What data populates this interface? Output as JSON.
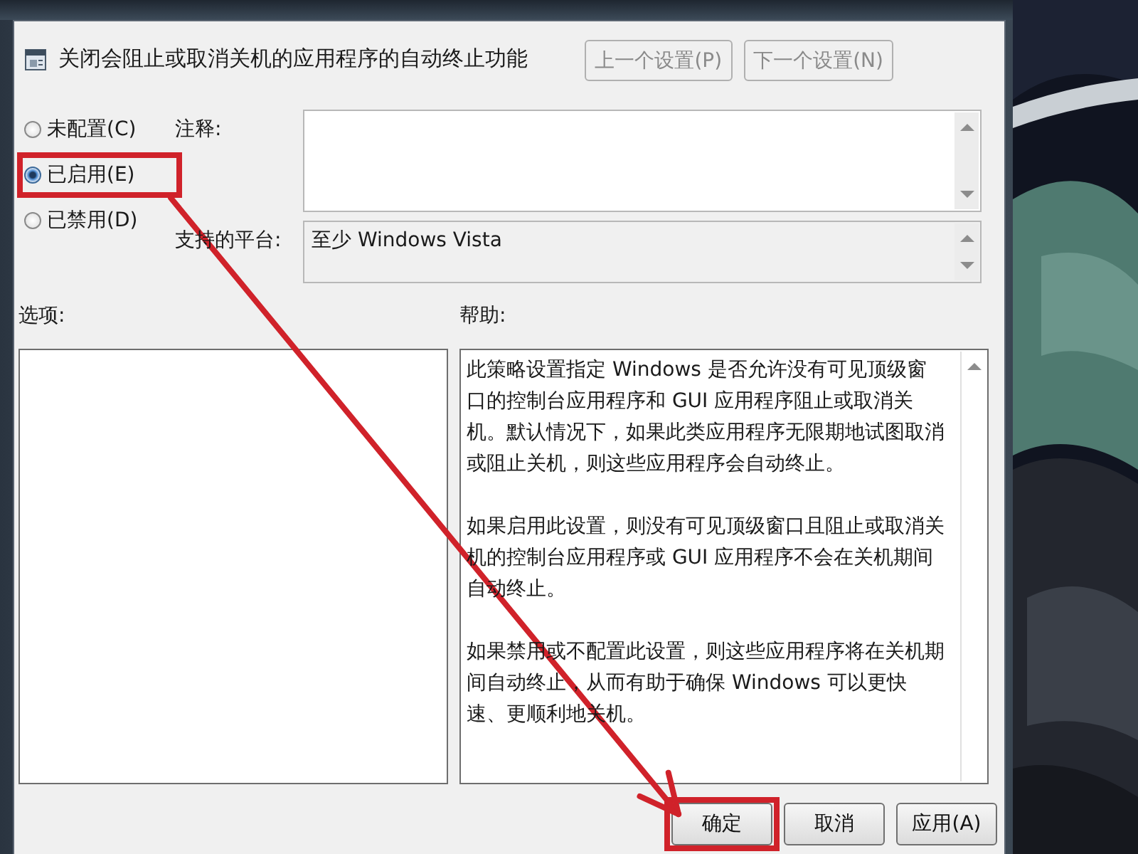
{
  "setting_title": "关闭会阻止或取消关机的应用程序的自动终止功能",
  "nav_buttons": [
    {
      "label": "上一个设置(P)",
      "disabled": true
    },
    {
      "label": "下一个设置(N)",
      "disabled": true
    }
  ],
  "state_options": [
    {
      "label": "未配置(C)",
      "selected": false,
      "highlighted": false
    },
    {
      "label": "已启用(E)",
      "selected": true,
      "highlighted": true
    },
    {
      "label": "已禁用(D)",
      "selected": false,
      "highlighted": false
    }
  ],
  "comment": {
    "label": "注释:"
  },
  "supported_platform": {
    "label": "支持的平台:",
    "value": "至少 Windows Vista"
  },
  "options": {
    "label": "选项:"
  },
  "help": {
    "label": "帮助:",
    "paragraphs": [
      "此策略设置指定 Windows 是否允许没有可见顶级窗口的控制台应用程序和 GUI 应用程序阻止或取消关机。默认情况下，如果此类应用程序无限期地试图取消或阻止关机，则这些应用程序会自动终止。",
      "如果启用此设置，则没有可见顶级窗口且阻止或取消关机的控制台应用程序或 GUI 应用程序不会在关机期间自动终止。",
      "如果禁用或不配置此设置，则这些应用程序将在关机期间自动终止，从而有助于确保 Windows 可以更快速、更顺利地关机。"
    ]
  },
  "buttons": [
    {
      "label": "确定",
      "highlighted": true
    },
    {
      "label": "取消",
      "highlighted": false
    },
    {
      "label": "应用(A)",
      "highlighted": false
    }
  ],
  "annotations": {
    "arrow": true
  }
}
